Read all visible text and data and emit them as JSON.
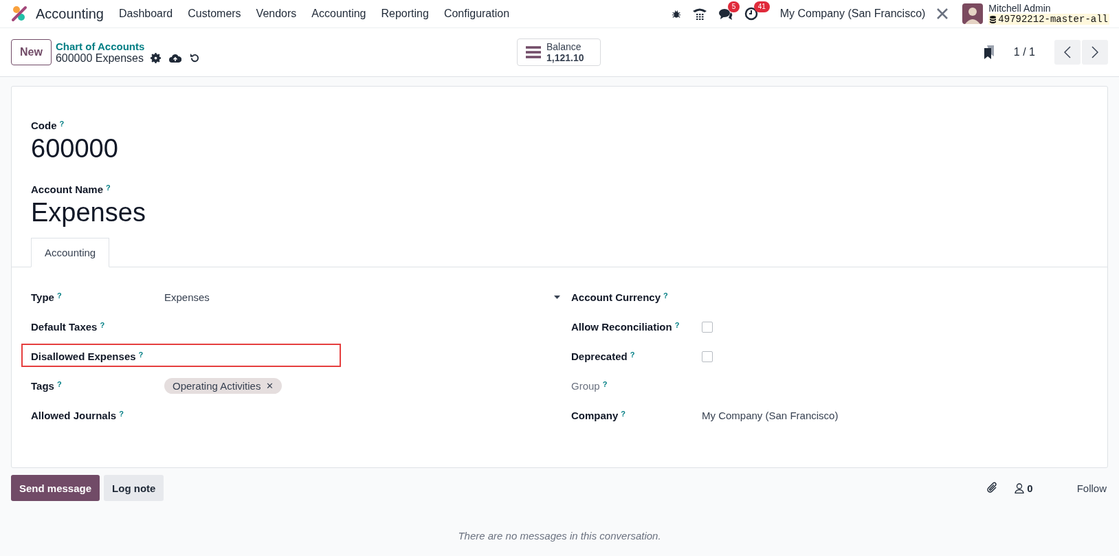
{
  "navbar": {
    "app_name": "Accounting",
    "menu": [
      "Dashboard",
      "Customers",
      "Vendors",
      "Accounting",
      "Reporting",
      "Configuration"
    ],
    "messages_count": "5",
    "activities_count": "41",
    "company": "My Company (San Francisco)",
    "user_name": "Mitchell Admin",
    "database": "49792212-master-all"
  },
  "control_panel": {
    "new_button": "New",
    "breadcrumb": "Chart of Accounts",
    "record_name": "600000 Expenses",
    "smart_button": {
      "label": "Balance",
      "value": "1,121.10"
    },
    "pager": "1 / 1"
  },
  "form": {
    "code_label": "Code",
    "help_mark": "?",
    "code": "600000",
    "name_label": "Account Name",
    "name": "Expenses",
    "tabs": [
      {
        "label": "Accounting",
        "selected": true
      }
    ],
    "left_fields": [
      {
        "kind": "select",
        "label": "Type",
        "help": "?",
        "value": "Expenses",
        "readonly": false,
        "highlighted": false
      },
      {
        "kind": "empty",
        "label": "Default Taxes",
        "help": "?",
        "readonly": false,
        "highlighted": false
      },
      {
        "kind": "empty",
        "label": "Disallowed Expenses",
        "help": "?",
        "readonly": false,
        "highlighted": true
      },
      {
        "kind": "tags",
        "label": "Tags",
        "help": "?",
        "tags": [
          "Operating Activities"
        ],
        "remove_mark": "✕",
        "readonly": false,
        "highlighted": false
      },
      {
        "kind": "empty",
        "label": "Allowed Journals",
        "help": "?",
        "readonly": false,
        "highlighted": false
      }
    ],
    "right_fields": [
      {
        "kind": "empty",
        "label": "Account Currency",
        "help": "?",
        "readonly": false,
        "highlighted": false
      },
      {
        "kind": "checkbox",
        "label": "Allow Reconciliation",
        "help": "?",
        "checked": false,
        "readonly": false,
        "highlighted": false
      },
      {
        "kind": "checkbox",
        "label": "Deprecated",
        "help": "?",
        "checked": false,
        "readonly": false,
        "highlighted": false
      },
      {
        "kind": "empty",
        "label": "Group",
        "help": "?",
        "readonly": true,
        "highlighted": false
      },
      {
        "kind": "text",
        "label": "Company",
        "help": "?",
        "value": "My Company (San Francisco)",
        "readonly": false,
        "highlighted": false
      }
    ]
  },
  "chatter": {
    "send_message": "Send message",
    "log_note": "Log note",
    "followers_count": "0",
    "follow": "Follow",
    "empty_message": "There are no messages in this conversation."
  }
}
